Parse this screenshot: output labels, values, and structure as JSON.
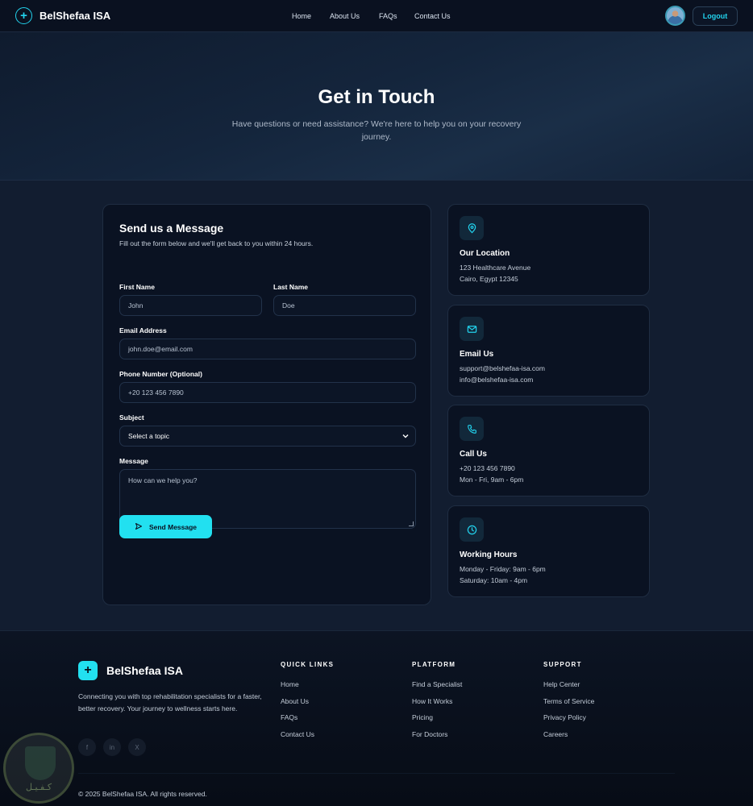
{
  "nav": {
    "brand": "BelShefaa ISA",
    "links": [
      "Home",
      "About Us",
      "FAQs",
      "Contact Us"
    ],
    "logout_label": "Logout"
  },
  "hero": {
    "title": "Get in Touch",
    "subtitle": "Have questions or need assistance? We're here to help you on your recovery journey."
  },
  "form": {
    "title": "Send us a Message",
    "subtitle": "Fill out the form below and we'll get back to you within 24 hours.",
    "first_name": {
      "label": "First Name",
      "placeholder": "John"
    },
    "last_name": {
      "label": "Last Name",
      "placeholder": "Doe"
    },
    "email": {
      "label": "Email Address",
      "placeholder": "john.doe@email.com"
    },
    "phone": {
      "label": "Phone Number (Optional)",
      "placeholder": "+20 123 456 7890"
    },
    "subject": {
      "label": "Subject",
      "selected": "Select a topic"
    },
    "message": {
      "label": "Message",
      "placeholder": "How can we help you?"
    },
    "submit_label": "Send Message"
  },
  "info_cards": [
    {
      "icon": "map-pin-icon",
      "title": "Our Location",
      "lines": [
        "123 Healthcare Avenue",
        "Cairo, Egypt 12345"
      ]
    },
    {
      "icon": "mail-icon",
      "title": "Email Us",
      "lines": [
        "support@belshefaa-isa.com",
        "info@belshefaa-isa.com"
      ]
    },
    {
      "icon": "phone-icon",
      "title": "Call Us",
      "lines": [
        "+20 123 456 7890",
        "Mon - Fri, 9am - 6pm"
      ]
    },
    {
      "icon": "clock-icon",
      "title": "Working Hours",
      "lines": [
        "Monday - Friday: 9am - 6pm",
        "Saturday: 10am - 4pm"
      ]
    }
  ],
  "footer": {
    "brand": "BelShefaa ISA",
    "description": "Connecting you with top rehabilitation specialists for a faster, better recovery. Your journey to wellness starts here.",
    "socials": [
      "f",
      "in",
      "X"
    ],
    "columns": [
      {
        "title": "QUICK LINKS",
        "links": [
          "Home",
          "About Us",
          "FAQs",
          "Contact Us"
        ]
      },
      {
        "title": "PLATFORM",
        "links": [
          "Find a Specialist",
          "How It Works",
          "Pricing",
          "For Doctors"
        ]
      },
      {
        "title": "SUPPORT",
        "links": [
          "Help Center",
          "Terms of Service",
          "Privacy Policy",
          "Careers"
        ]
      }
    ],
    "copyright": "© 2025 BelShefaa ISA. All rights reserved."
  },
  "watermark_text": "كـفـيـل",
  "colors": {
    "accent": "#22e0f0",
    "background": "#121d30",
    "card": "#0a1222"
  }
}
